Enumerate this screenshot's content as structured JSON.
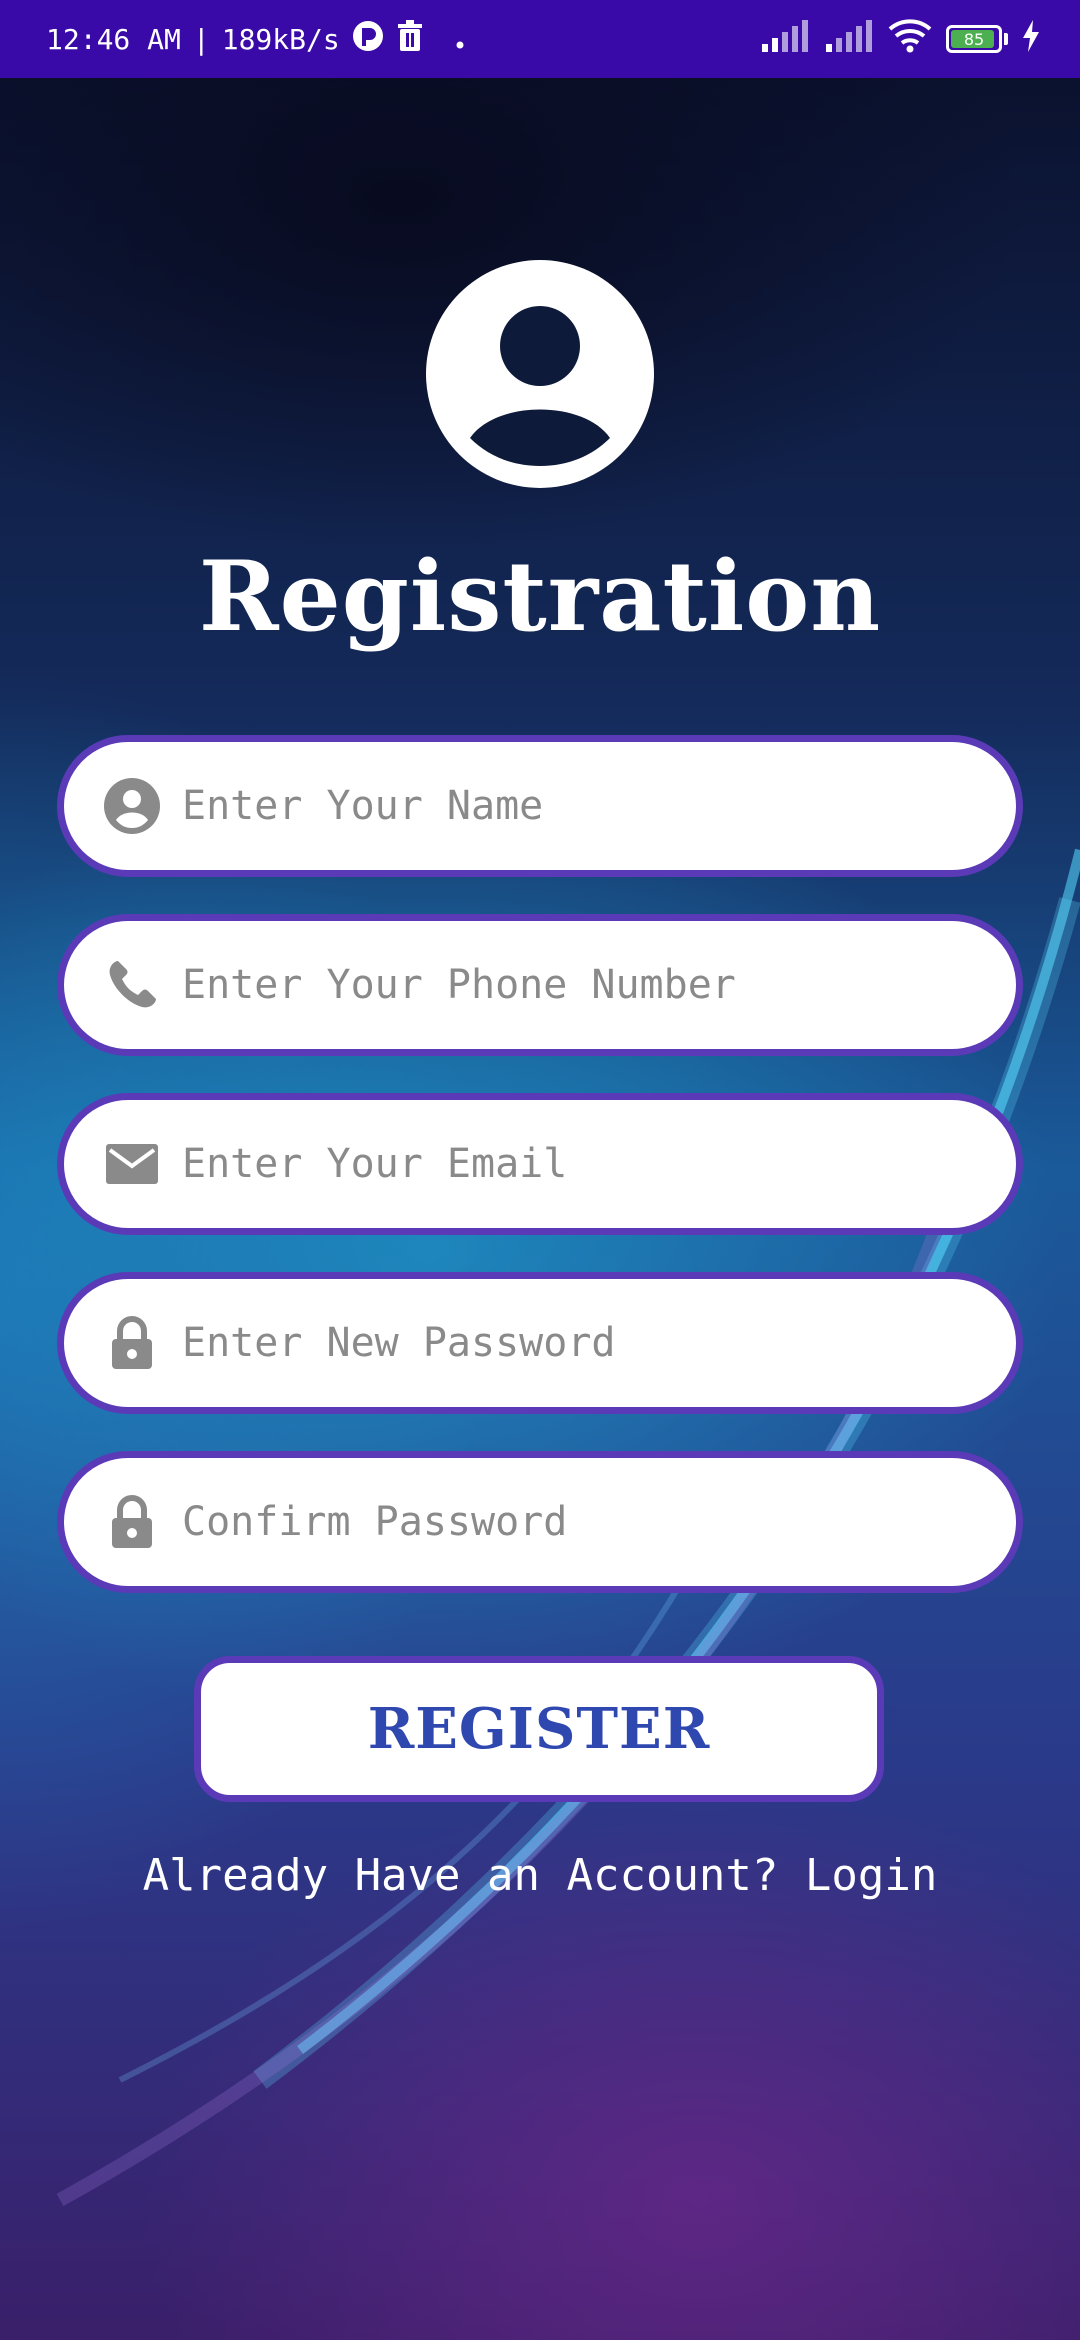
{
  "status_bar": {
    "time": "12:46 AM",
    "separator": "|",
    "network_speed": "189kB/s",
    "battery_level": "85",
    "icons": [
      "app-notification-icon",
      "trash-icon",
      "dot-icon",
      "signal-icon",
      "signal-icon",
      "wifi-icon",
      "battery-icon",
      "charging-icon"
    ]
  },
  "header": {
    "title": "Registration",
    "avatar_icon": "account-circle-icon"
  },
  "form": {
    "name_placeholder": "Enter Your Name",
    "phone_placeholder": "Enter Your Phone Number",
    "email_placeholder": "Enter Your Email",
    "password_placeholder": "Enter New Password",
    "confirm_password_placeholder": "Confirm Password",
    "register_label": "REGISTER",
    "login_link": "Already Have an Account? Login"
  },
  "colors": {
    "status_bar": "#3a0aa8",
    "field_border": "#5b3ab8",
    "button_text": "#2f48b0",
    "placeholder": "#8a8a8a"
  }
}
